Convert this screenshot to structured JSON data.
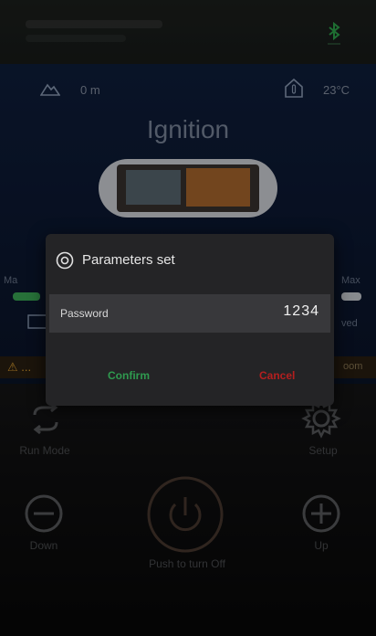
{
  "header": {
    "altitude": "0 m",
    "temperature": "23°C"
  },
  "main": {
    "title": "Ignition",
    "min_label": "Ma",
    "max_label": "Max",
    "right_label": "ved",
    "warning_left": "⚠ ...",
    "warning_right": "oom"
  },
  "controls": {
    "run_mode": "Run Mode",
    "setup": "Setup",
    "down": "Down",
    "up": "Up",
    "power": "Push to turn Off"
  },
  "dialog": {
    "title": "Parameters set",
    "password_label": "Password",
    "password_value": "1234",
    "confirm": "Confirm",
    "cancel": "Cancel"
  },
  "colors": {
    "confirm": "#2f9a4f",
    "cancel": "#b41f1f",
    "accent_bar": "#3cae58"
  }
}
